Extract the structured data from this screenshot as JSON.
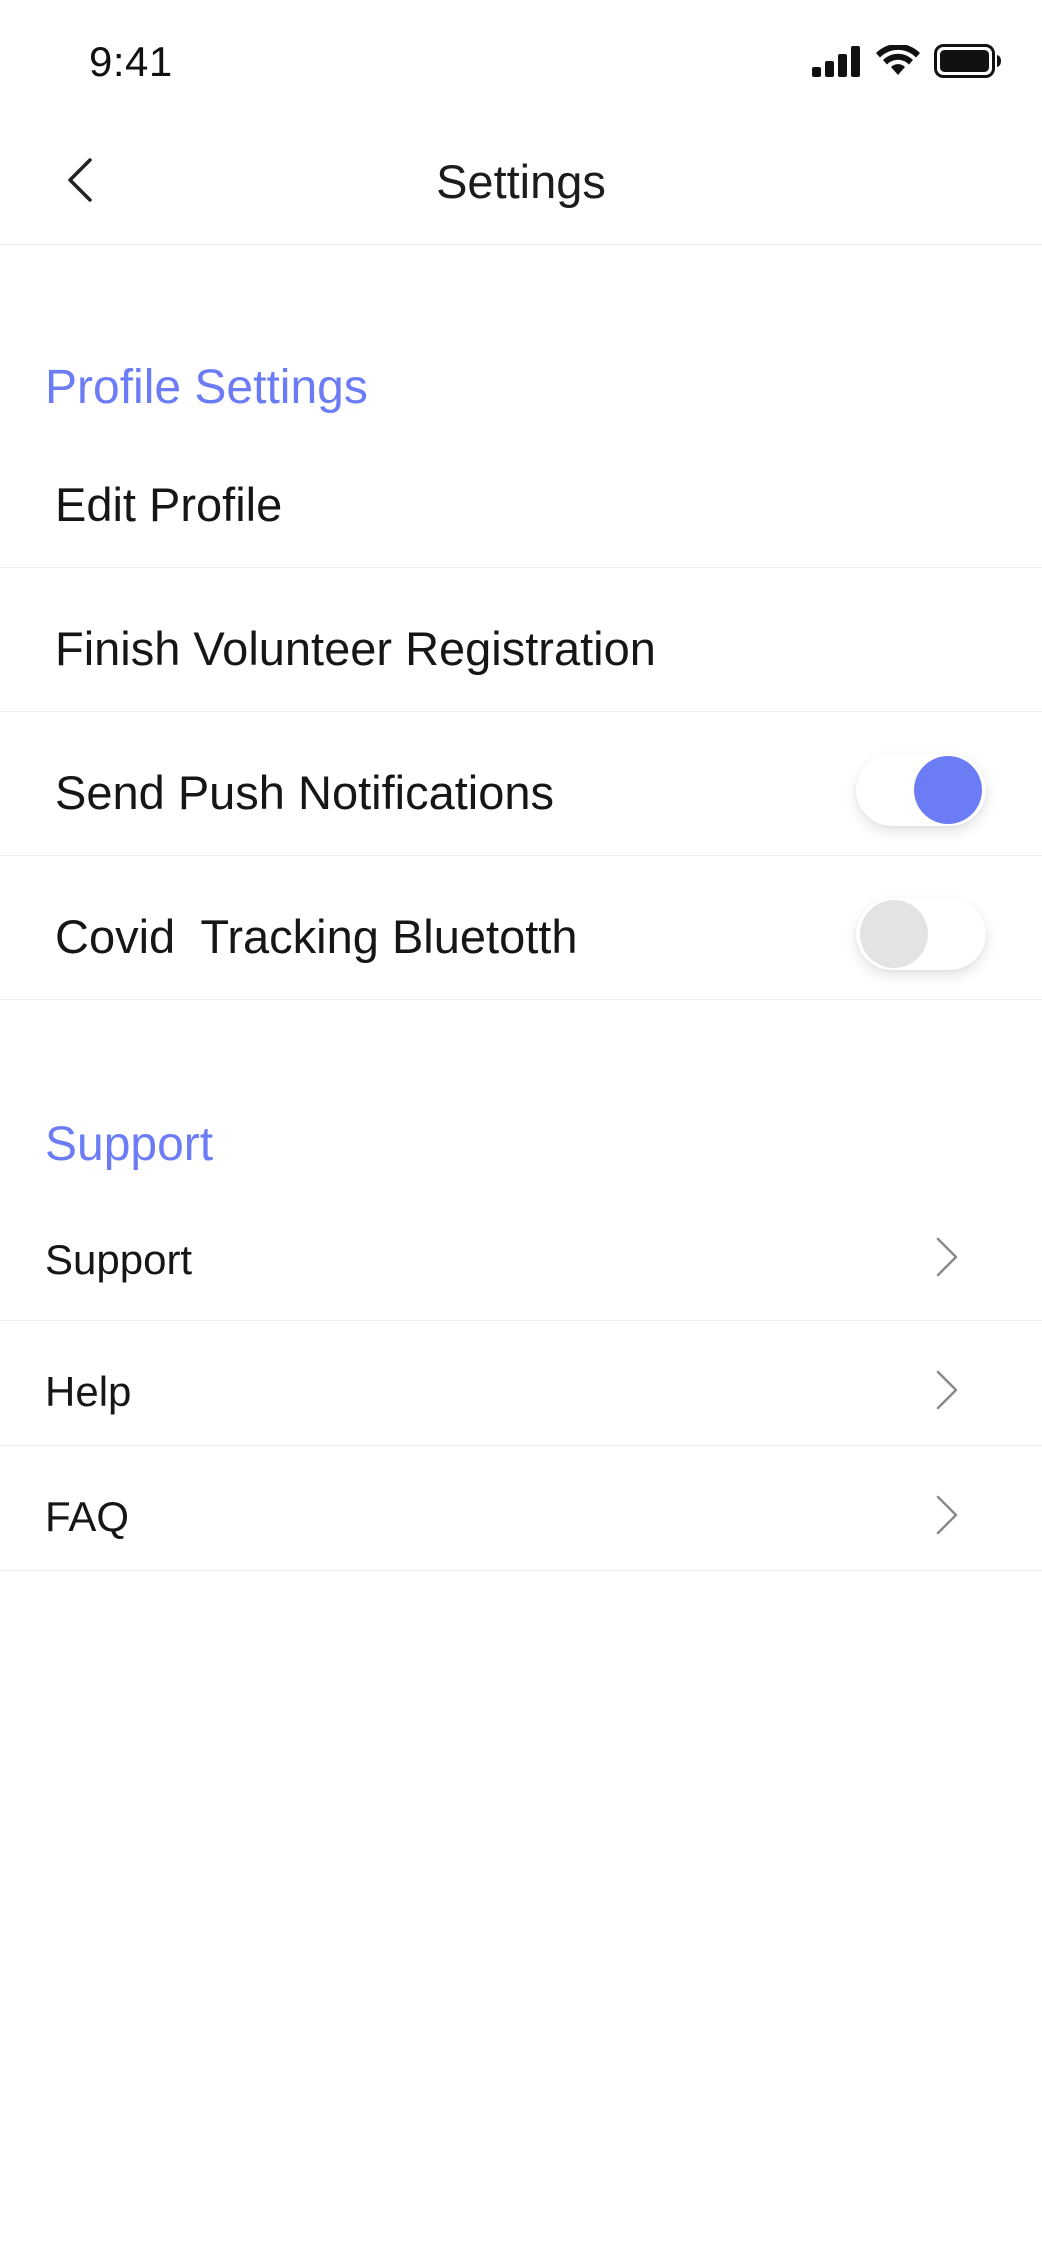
{
  "status_bar": {
    "time": "9:41",
    "icons": [
      "signal-icon",
      "wifi-icon",
      "battery-icon"
    ]
  },
  "nav": {
    "title": "Settings",
    "back_icon": "chevron-left-icon"
  },
  "profile_section": {
    "title": "Profile Settings",
    "items": [
      {
        "label": "Edit Profile"
      },
      {
        "label": "Finish Volunteer Registration"
      },
      {
        "label": "Send Push Notifications",
        "toggle": true
      },
      {
        "label": "Covid  Tracking Bluetotth",
        "toggle": false
      }
    ]
  },
  "support_section": {
    "title": "Support",
    "items": [
      {
        "label": "Support",
        "icon": "chevron-right-icon"
      },
      {
        "label": "Help",
        "icon": "chevron-right-icon"
      },
      {
        "label": "FAQ",
        "icon": "chevron-right-icon"
      }
    ]
  },
  "colors": {
    "accent": "#6c7cf5",
    "toggle_off_knob": "#e3e3e5",
    "divider": "#efeff1"
  }
}
